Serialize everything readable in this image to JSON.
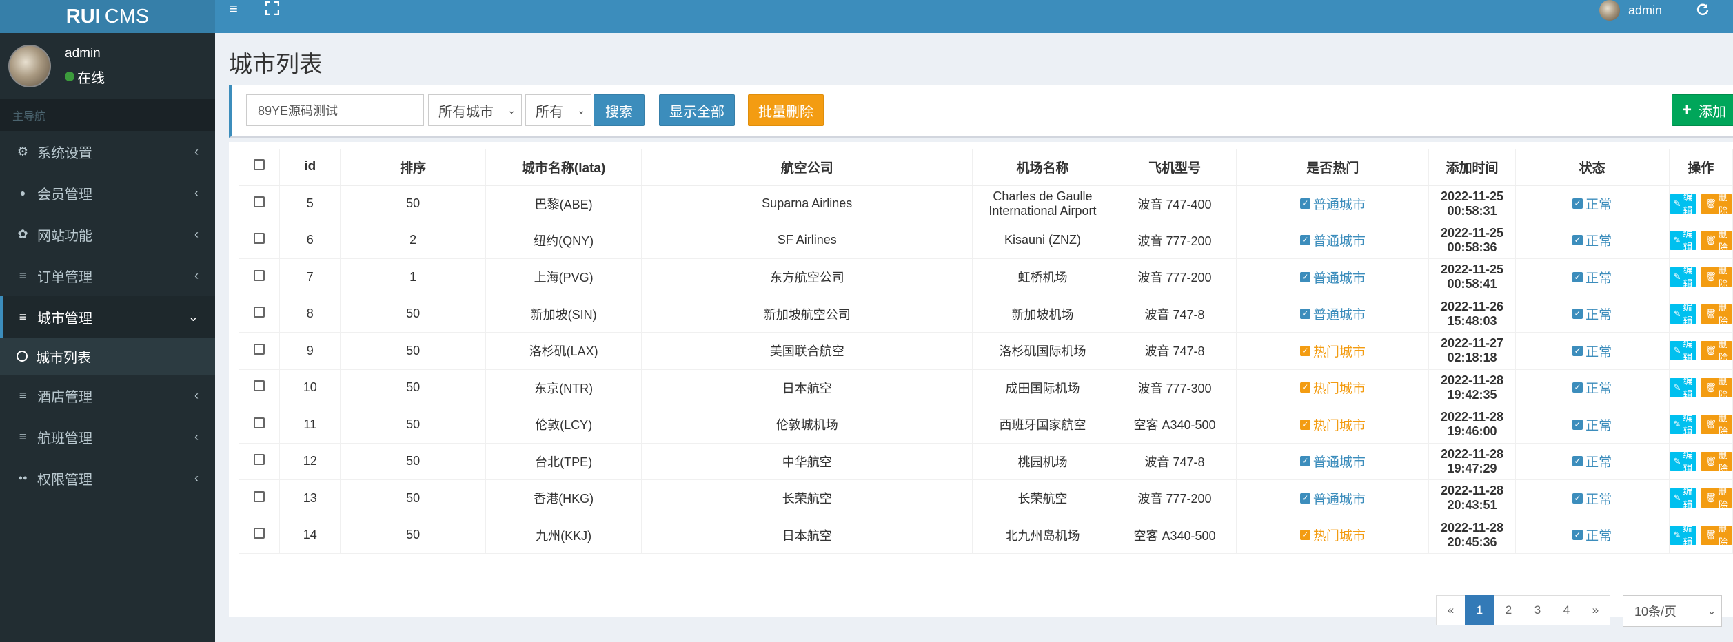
{
  "app": {
    "logo_bold": "RUI",
    "logo_rest": "CMS"
  },
  "user": {
    "name": "admin",
    "status": "在线"
  },
  "sidebar": {
    "header": "主导航",
    "items": [
      {
        "label": "系统设置",
        "icon": "cogs-icon"
      },
      {
        "label": "会员管理",
        "icon": "user-icon"
      },
      {
        "label": "网站功能",
        "icon": "gear-icon"
      },
      {
        "label": "订单管理",
        "icon": "list-icon"
      },
      {
        "label": "城市管理",
        "icon": "list-icon",
        "active": true
      },
      {
        "label": "酒店管理",
        "icon": "list-icon"
      },
      {
        "label": "航班管理",
        "icon": "list-icon"
      },
      {
        "label": "权限管理",
        "icon": "users-icon"
      }
    ],
    "sub_item": "城市列表"
  },
  "topbar": {
    "user": "admin"
  },
  "page": {
    "title": "城市列表"
  },
  "filters": {
    "search_value": "89YE源码测试",
    "city_select": "所有城市",
    "type_select": "所有",
    "search_btn": "搜索",
    "show_all_btn": "显示全部",
    "batch_delete_btn": "批量删除",
    "add_btn": "添加"
  },
  "table": {
    "headers": [
      "id",
      "排序",
      "城市名称(Iata)",
      "航空公司",
      "机场名称",
      "飞机型号",
      "是否热门",
      "添加时间",
      "状态",
      "操作"
    ],
    "edit_label": "编辑",
    "delete_label": "删除",
    "rows": [
      {
        "id": "5",
        "sort": "50",
        "city": "巴黎(ABE)",
        "airline": "Suparna Airlines",
        "airport": "Charles de Gaulle International Airport",
        "plane": "波音 747-400",
        "hot": "普通城市",
        "hot_type": "normal",
        "time": "2022-11-25 00:58:31",
        "status": "正常"
      },
      {
        "id": "6",
        "sort": "2",
        "city": "纽约(QNY)",
        "airline": "SF Airlines",
        "airport": "Kisauni (ZNZ)",
        "plane": "波音 777-200",
        "hot": "普通城市",
        "hot_type": "normal",
        "time": "2022-11-25 00:58:36",
        "status": "正常"
      },
      {
        "id": "7",
        "sort": "1",
        "city": "上海(PVG)",
        "airline": "东方航空公司",
        "airport": "虹桥机场",
        "plane": "波音 777-200",
        "hot": "普通城市",
        "hot_type": "normal",
        "time": "2022-11-25 00:58:41",
        "status": "正常"
      },
      {
        "id": "8",
        "sort": "50",
        "city": "新加坡(SIN)",
        "airline": "新加坡航空公司",
        "airport": "新加坡机场",
        "plane": "波音 747-8",
        "hot": "普通城市",
        "hot_type": "normal",
        "time": "2022-11-26 15:48:03",
        "status": "正常"
      },
      {
        "id": "9",
        "sort": "50",
        "city": "洛杉矶(LAX)",
        "airline": "美国联合航空",
        "airport": "洛杉矶国际机场",
        "plane": "波音 747-8",
        "hot": "热门城市",
        "hot_type": "hot",
        "time": "2022-11-27 02:18:18",
        "status": "正常"
      },
      {
        "id": "10",
        "sort": "50",
        "city": "东京(NTR)",
        "airline": "日本航空",
        "airport": "成田国际机场",
        "plane": "波音 777-300",
        "hot": "热门城市",
        "hot_type": "hot",
        "time": "2022-11-28 19:42:35",
        "status": "正常"
      },
      {
        "id": "11",
        "sort": "50",
        "city": "伦敦(LCY)",
        "airline": "伦敦城机场",
        "airport": "西班牙国家航空",
        "plane": "空客 A340-500",
        "hot": "热门城市",
        "hot_type": "hot",
        "time": "2022-11-28 19:46:00",
        "status": "正常"
      },
      {
        "id": "12",
        "sort": "50",
        "city": "台北(TPE)",
        "airline": "中华航空",
        "airport": "桃园机场",
        "plane": "波音 747-8",
        "hot": "普通城市",
        "hot_type": "normal",
        "time": "2022-11-28 19:47:29",
        "status": "正常"
      },
      {
        "id": "13",
        "sort": "50",
        "city": "香港(HKG)",
        "airline": "长荣航空",
        "airport": "长荣航空",
        "plane": "波音 777-200",
        "hot": "普通城市",
        "hot_type": "normal",
        "time": "2022-11-28 20:43:51",
        "status": "正常"
      },
      {
        "id": "14",
        "sort": "50",
        "city": "九州(KKJ)",
        "airline": "日本航空",
        "airport": "北九州岛机场",
        "plane": "空客 A340-500",
        "hot": "热门城市",
        "hot_type": "hot",
        "time": "2022-11-28 20:45:36",
        "status": "正常"
      }
    ]
  },
  "pagination": {
    "prev": "«",
    "pages": [
      "1",
      "2",
      "3",
      "4"
    ],
    "current": "1",
    "next": "»",
    "per_page": "10条/页"
  },
  "colors": {
    "primary": "#3c8dbc",
    "warning": "#f39c12",
    "success": "#00a65a",
    "info": "#00c0ef",
    "sidebar": "#222d32"
  }
}
